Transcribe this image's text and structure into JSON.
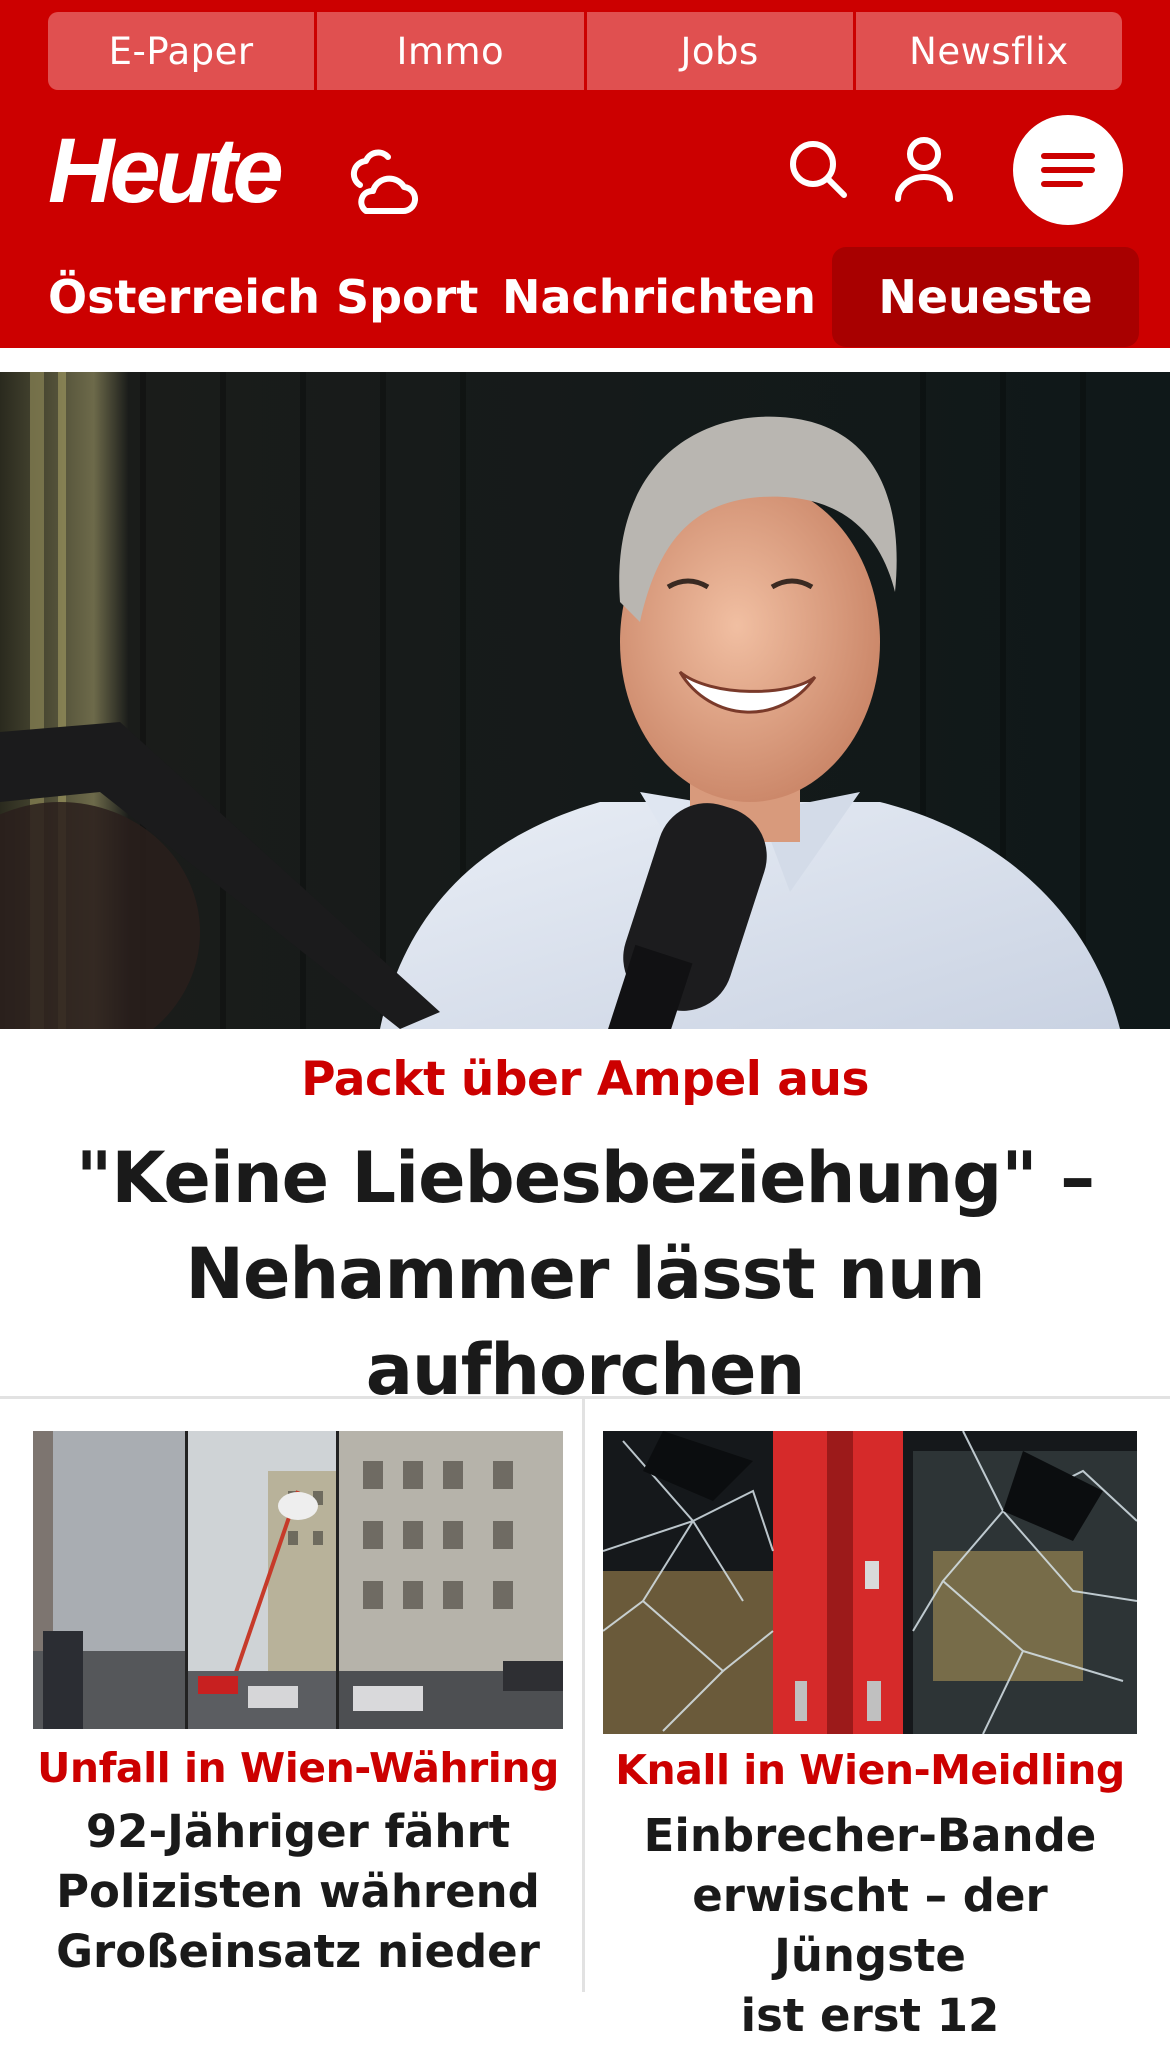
{
  "colors": {
    "brand_red": "#cc0000",
    "top_link_bg": "#e05050",
    "active_tab_bg": "#a80000",
    "headline_text": "#1a1a1a",
    "white": "#ffffff"
  },
  "top_links": [
    "E-Paper",
    "Immo",
    "Jobs",
    "Newsflix"
  ],
  "brand": {
    "logo_text": "Heute",
    "weather_icon": "weather-sun-cloud-icon",
    "search_icon": "search-icon",
    "account_icon": "user-icon",
    "menu_icon": "menu-icon"
  },
  "nav": {
    "items": [
      "Österreich",
      "Sport",
      "Nachrichten"
    ],
    "active": "Neueste"
  },
  "hero": {
    "image": "man-with-podcast-microphone-photo",
    "kicker": "Packt über Ampel aus",
    "title_line1": "\"Keine Liebesbeziehung\" –",
    "title_line2": "Nehammer lässt nun aufhorchen"
  },
  "cards": [
    {
      "image": "fire-brigade-street-photo",
      "kicker": "Unfall in Wien-Währing",
      "title_line1": "92-Jähriger fährt",
      "title_line2": "Polizisten während",
      "title_line3": "Großeinsatz nieder"
    },
    {
      "image": "broken-glass-door-photo",
      "kicker": "Knall in Wien-Meidling",
      "title_line1": "Einbrecher-Bande",
      "title_line2": "erwischt – der Jüngste",
      "title_line3": "ist erst 12"
    }
  ]
}
